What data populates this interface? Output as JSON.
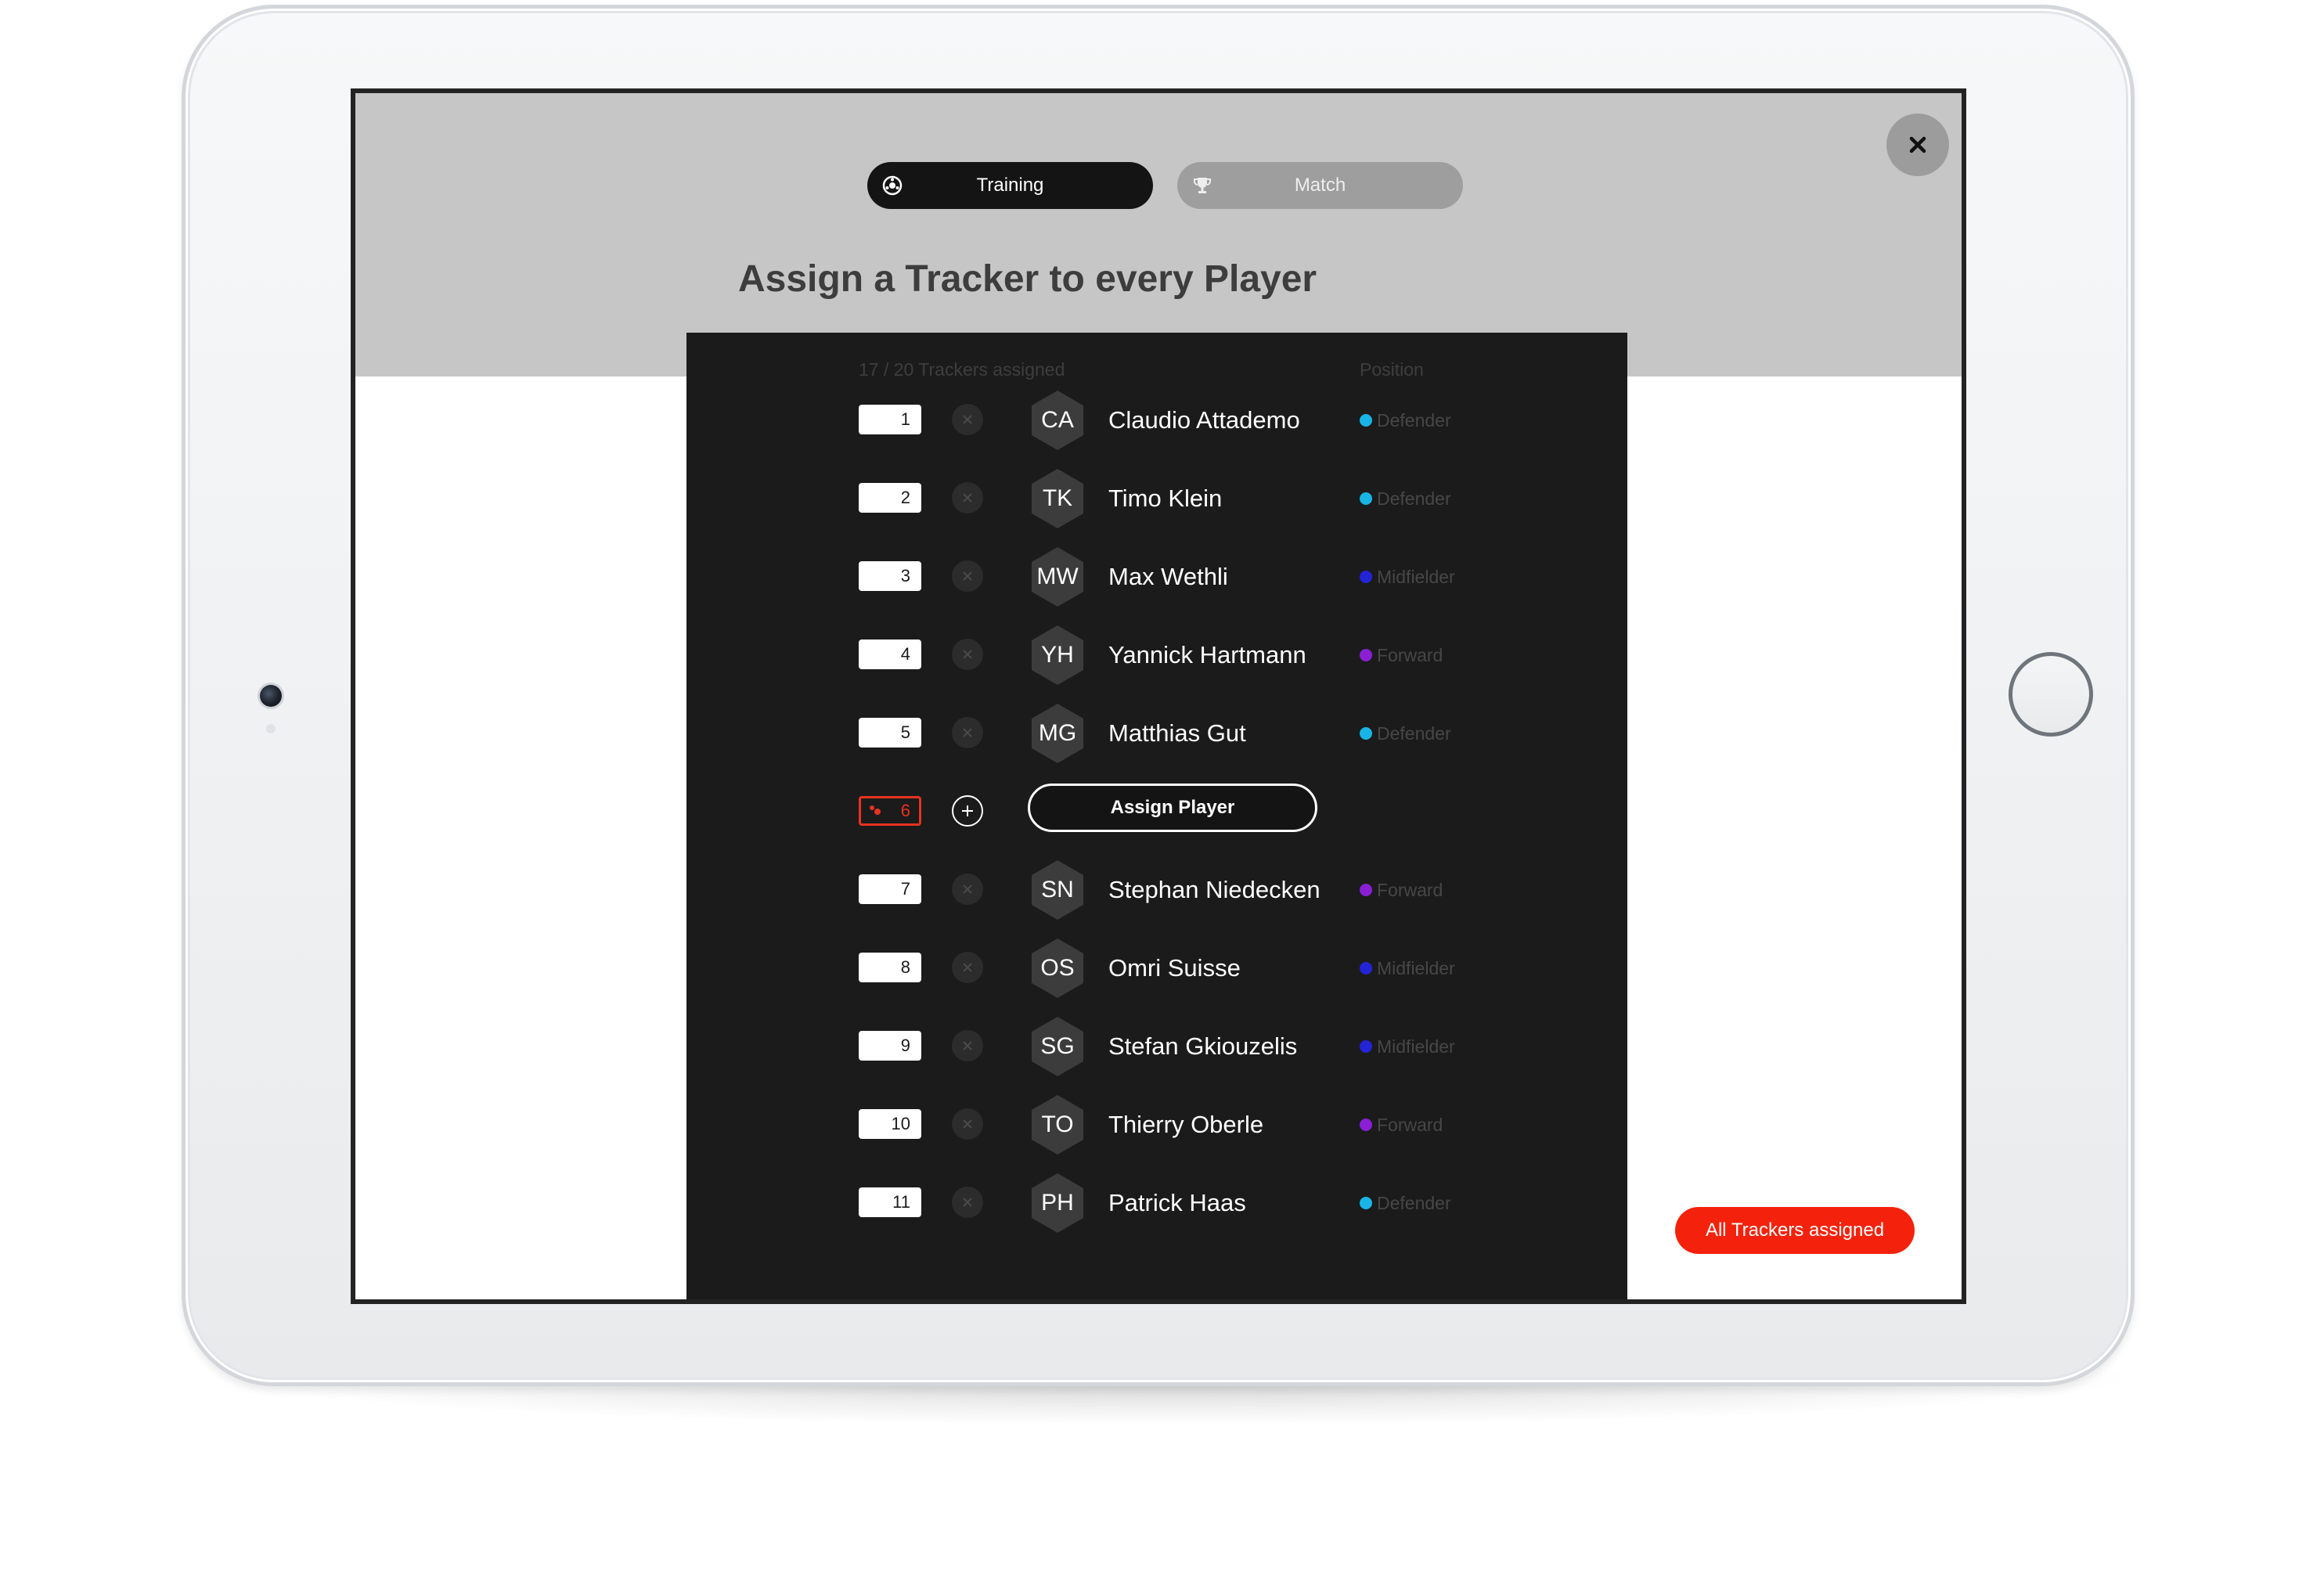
{
  "modes": [
    {
      "label": "Training",
      "icon": "soccer-ball-icon",
      "selected": true
    },
    {
      "label": "Match",
      "icon": "trophy-icon",
      "selected": false
    }
  ],
  "title": "Assign a Tracker to every Player",
  "roster": {
    "assigned_count": "17 / 20 Trackers assigned",
    "position_header": "Position",
    "rows": [
      {
        "tracker": "1",
        "initials": "CA",
        "name": "Claudio Attademo",
        "position": "Defender"
      },
      {
        "tracker": "2",
        "initials": "TK",
        "name": "Timo Klein",
        "position": "Defender"
      },
      {
        "tracker": "3",
        "initials": "MW",
        "name": "Max Wethli",
        "position": "Midfielder"
      },
      {
        "tracker": "4",
        "initials": "YH",
        "name": "Yannick Hartmann",
        "position": "Forward"
      },
      {
        "tracker": "5",
        "initials": "MG",
        "name": "Matthias Gut",
        "position": "Defender"
      },
      {
        "tracker": "6",
        "unassigned": true,
        "assign_label": "Assign Player"
      },
      {
        "tracker": "7",
        "initials": "SN",
        "name": "Stephan Niedecken",
        "position": "Forward"
      },
      {
        "tracker": "8",
        "initials": "OS",
        "name": "Omri Suisse",
        "position": "Midfielder"
      },
      {
        "tracker": "9",
        "initials": "SG",
        "name": "Stefan Gkiouzelis",
        "position": "Midfielder"
      },
      {
        "tracker": "10",
        "initials": "TO",
        "name": "Thierry Oberle",
        "position": "Forward"
      },
      {
        "tracker": "11",
        "initials": "PH",
        "name": "Patrick Haas",
        "position": "Defender"
      }
    ]
  },
  "position_colors": {
    "Defender": "#19b4e6",
    "Midfielder": "#2323d8",
    "Forward": "#8a1fd6"
  },
  "tracker_alert_color": "#e8321e",
  "all_assigned_label": "All Trackers assigned",
  "close_icon": "close-icon"
}
